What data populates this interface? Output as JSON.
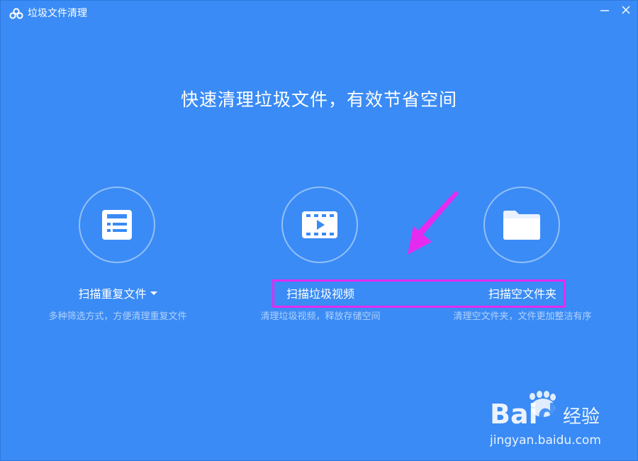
{
  "window": {
    "title": "垃圾文件清理",
    "controls": {
      "minimize_icon": "minimize-icon",
      "close_icon": "close-icon"
    }
  },
  "headline": "快速清理垃圾文件，有效节省空间",
  "features": [
    {
      "icon": "list-document-icon",
      "title": "扫描重复文件",
      "has_dropdown": true,
      "description": "多种筛选方式，方便清理重复文件"
    },
    {
      "icon": "video-film-icon",
      "title": "扫描垃圾视频",
      "has_dropdown": false,
      "description": "清理垃圾视频，释放存储空间"
    },
    {
      "icon": "folder-icon",
      "title": "扫描空文件夹",
      "has_dropdown": false,
      "description": "清理空文件夹，文件更加整洁有序"
    }
  ],
  "watermark": {
    "brand_prefix": "Bai",
    "brand_suffix": "du",
    "brand_cn": "经验",
    "url": "jingyan.baidu.com"
  },
  "colors": {
    "background": "#3a8bf5",
    "annotation": "#e52bef",
    "icon_fill": "#ffffff"
  }
}
